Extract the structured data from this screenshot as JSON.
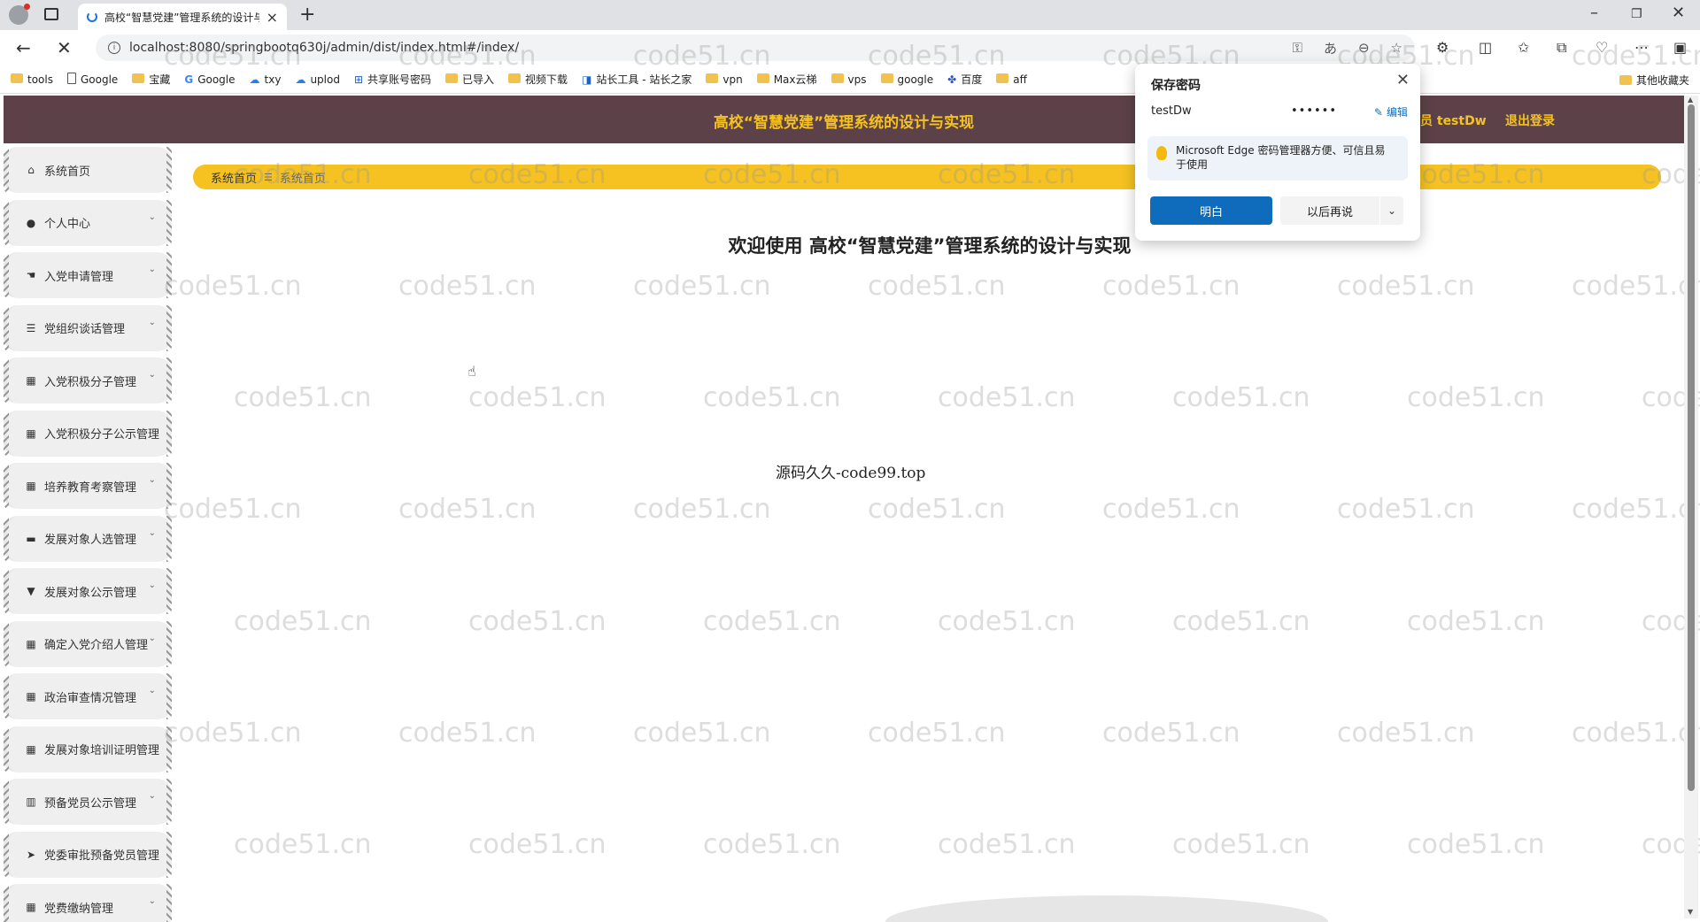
{
  "browser": {
    "tab_title": "高校“智慧党建”管理系统的设计与",
    "url": "localhost:8080/springbootq630j/admin/dist/index.html#/index/",
    "bookmarks": [
      {
        "label": "tools",
        "icon": "folder-icon"
      },
      {
        "label": "Google",
        "icon": "page-icon"
      },
      {
        "label": "宝藏",
        "icon": "folder-icon"
      },
      {
        "label": "Google",
        "icon": "google-icon"
      },
      {
        "label": "txy",
        "icon": "cloud-icon"
      },
      {
        "label": "uplod",
        "icon": "cloud-icon"
      },
      {
        "label": "共享账号密码",
        "icon": "share-icon"
      },
      {
        "label": "已导入",
        "icon": "folder-icon"
      },
      {
        "label": "视频下载",
        "icon": "folder-icon"
      },
      {
        "label": "站长工具 - 站长之家",
        "icon": "tool-icon"
      },
      {
        "label": "vpn",
        "icon": "folder-icon"
      },
      {
        "label": "Max云梯",
        "icon": "folder-icon"
      },
      {
        "label": "vps",
        "icon": "folder-icon"
      },
      {
        "label": "google",
        "icon": "folder-icon"
      },
      {
        "label": "百度",
        "icon": "baidu-icon"
      },
      {
        "label": "aff",
        "icon": "folder-icon"
      }
    ],
    "other_bookmarks": "其他收藏夹"
  },
  "header": {
    "title": "高校“智慧党建”管理系统的设计与实现",
    "user_label": "员 testDw",
    "logout": "退出登录",
    "bg_color": "#5c4248",
    "accent_color": "#f5c222"
  },
  "sidebar": {
    "items": [
      {
        "label": "系统首页",
        "icon": "home-icon",
        "has_chevron": false
      },
      {
        "label": "个人中心",
        "icon": "user-icon",
        "has_chevron": true
      },
      {
        "label": "入党申请管理",
        "icon": "hand-icon",
        "has_chevron": true
      },
      {
        "label": "党组织谈话管理",
        "icon": "list-icon",
        "has_chevron": true
      },
      {
        "label": "入党积极分子管理",
        "icon": "grid-icon",
        "has_chevron": true
      },
      {
        "label": "入党积极分子公示管理",
        "icon": "grid-icon",
        "has_chevron": false
      },
      {
        "label": "培养教育考察管理",
        "icon": "grid-icon",
        "has_chevron": true
      },
      {
        "label": "发展对象人选管理",
        "icon": "briefcase-icon",
        "has_chevron": true
      },
      {
        "label": "发展对象公示管理",
        "icon": "chat-icon",
        "has_chevron": true
      },
      {
        "label": "确定入党介绍人管理",
        "icon": "grid-icon",
        "has_chevron": true
      },
      {
        "label": "政治审查情况管理",
        "icon": "grid-icon",
        "has_chevron": true
      },
      {
        "label": "发展对象培训证明管理",
        "icon": "grid-icon",
        "has_chevron": false
      },
      {
        "label": "预备党员公示管理",
        "icon": "chart-icon",
        "has_chevron": true
      },
      {
        "label": "党委审批预备党员管理",
        "icon": "send-icon",
        "has_chevron": false
      },
      {
        "label": "党费缴纳管理",
        "icon": "grid-icon",
        "has_chevron": true
      }
    ]
  },
  "main": {
    "breadcrumb": {
      "current": "系统首页",
      "sub": "系统首页"
    },
    "welcome": "欢迎使用 高校“智慧党建”管理系统的设计与实现",
    "source_text": "源码久久-code99.top"
  },
  "watermark": "code51.cn",
  "popup": {
    "title": "保存密码",
    "username": "testDw",
    "password_mask": "••••••",
    "edit": "编辑",
    "tip": "Microsoft Edge 密码管理器方便、可信且易于使用",
    "primary": "明白",
    "secondary": "以后再说"
  }
}
